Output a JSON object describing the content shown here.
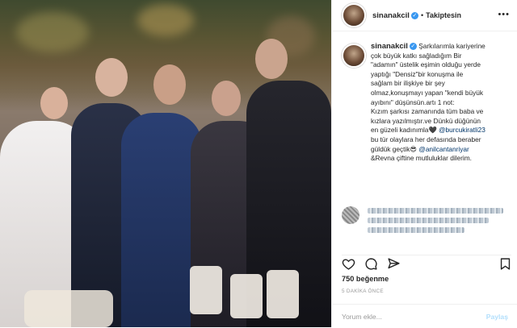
{
  "post": {
    "username": "sinanakcil",
    "follow_status": "Takiptesin",
    "more_label": "•••",
    "caption": {
      "username": "sinanakcil",
      "text_1": "Şarkılarımla kariyerine\nçok büyük katkı sağladığım Bir\n\"adamın\" üstelik eşimin olduğu yerde\nyaptığı \"Densiz\"bir konuşma ile\nsağlam bir ilişkiye bir şey\nolmaz,konuşmayı yapan \"kendi büyük\nayıbını\" düşünsün.artı 1 not:\nKızım şarkısı zamanında tüm baba ve\nkızlara yazılmıştır.ve Dünkü düğünün\nen güzeli kadınımla🖤 ",
      "tag_1": "@burcukiratli23",
      "text_2": "\nbu tür olaylara her defasında beraber\ngüldük geçtik😎 ",
      "tag_2": "@anilcantanriyar",
      "text_3": "\n&Revna çiftine mutluluklar dilerim."
    },
    "likes": "750 beğenme",
    "time": "5 DAKİKA ÖNCE",
    "comment_placeholder": "Yorum ekle...",
    "share_label": "Paylaş"
  },
  "icons": {
    "verified": "verified-badge-icon",
    "like": "heart-icon",
    "comment": "comment-icon",
    "share": "share-icon",
    "save": "bookmark-icon"
  },
  "colors": {
    "verified_blue": "#3897f0",
    "tag_link": "#003569",
    "muted": "#999999",
    "share_disabled": "#b2dffc"
  }
}
